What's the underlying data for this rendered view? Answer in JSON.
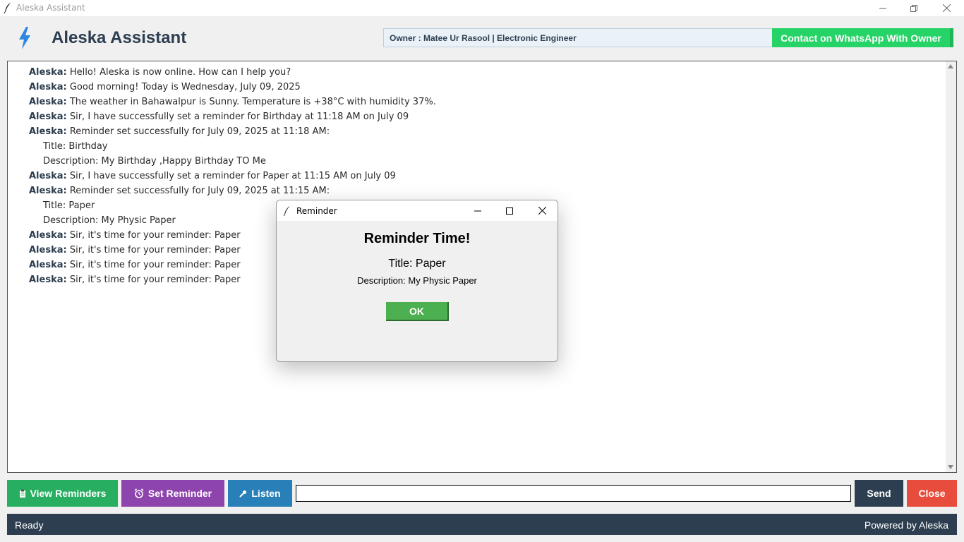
{
  "window": {
    "title": "Aleska Assistant"
  },
  "header": {
    "title": "Aleska Assistant",
    "owner": "Owner : Matee Ur Rasool | Electronic Engineer",
    "whatsapp_label": "Contact on WhatsApp With Owner"
  },
  "chat": {
    "speaker": "Aleska:",
    "messages": [
      "Hello! Aleska is now online. How can I help you?",
      "Good morning! Today is Wednesday, July 09, 2025",
      "The weather in Bahawalpur is Sunny. Temperature is +38°C with humidity 37%.",
      "Sir, I have successfully set a reminder for Birthday at 11:18 AM on July 09",
      "Reminder set successfully for July 09, 2025 at 11:18 AM:",
      "Sir, I have successfully set a reminder for Paper at 11:15 AM on July 09",
      "Reminder set successfully for July 09, 2025 at 11:15 AM:",
      "Sir, it's time for your reminder: Paper",
      "Sir, it's time for your reminder: Paper",
      "Sir, it's time for your reminder: Paper",
      "Sir, it's time for your reminder: Paper"
    ],
    "details": [
      "Title: Birthday",
      "Description: My Birthday ,Happy Birthday TO Me",
      "Title: Paper",
      "Description: My Physic Paper"
    ]
  },
  "toolbar": {
    "view_reminders": "View Reminders",
    "set_reminder": "Set Reminder",
    "listen": "Listen",
    "input_value": "",
    "send": "Send",
    "close": "Close"
  },
  "status": {
    "left": "Ready",
    "right": "Powered by Aleska"
  },
  "dialog": {
    "window_title": "Reminder",
    "heading": "Reminder Time!",
    "title_line": "Title: Paper",
    "description_line": "Description: My Physic Paper",
    "ok_label": "OK"
  },
  "colors": {
    "view_reminders": "#27ae60",
    "set_reminder": "#8e44ad",
    "listen": "#2980b9",
    "send": "#2c3e50",
    "close": "#e74c3c",
    "whatsapp": "#25d366",
    "statusbar": "#2c3e50",
    "ok": "#4caf50"
  }
}
